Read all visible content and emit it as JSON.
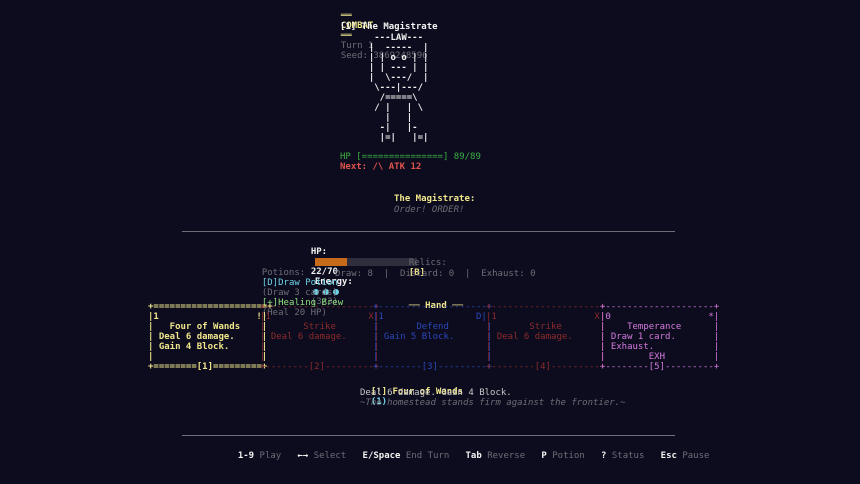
{
  "header": {
    "mode_label": "COMBAT",
    "turn": "Turn 1",
    "seed": "Seed: 3869248596"
  },
  "enemy": {
    "title": "[1] The Magistrate",
    "art": "   ---LAW---\n  |  -----  |\n  | | o o | |\n  | | --- | |\n  |  \\---/  |\n   \\---|---/\n    /=====\\\n   / |   | \\\n     |   |\n    -|   |-\n    |=|   |=|",
    "hp_bar": "HP [===============] 89/89",
    "intent": "Next: /\\ ATK 12",
    "speaker": "The Magistrate:",
    "dialogue": "Order! ORDER!"
  },
  "player": {
    "hp_label": "HP:",
    "hp_value": "22/70",
    "hp_fraction": 0.314,
    "energy_label": "Energy:",
    "energy_text": "(3/3)",
    "energy_current": 3,
    "relics_label": "Relics:",
    "relics_value": "[B]",
    "potions_label": "Potions:",
    "potion1_key": "[D]",
    "potion1_name": "Draw Potion",
    "potion1_desc": "(Draw 3 cards)",
    "potion2_key": "[+]",
    "potion2_name": "Healing Brew",
    "potion2_desc": "(Heal 20 HP)",
    "piles": "Draw: 8  |  Discard: 0  |  Exhaust: 0"
  },
  "hand": {
    "title": "Hand",
    "cards": [
      {
        "text": "+=====================+\n|1                  !|\n|   Four of Wands    |\n| Deal 6 damage.     |\n| Gain 4 Block.      |\n|                    |\n+========[1]=========+",
        "color": "#f0e68c"
      },
      {
        "text": "+--------------------+\n|1                  X|\n|       Strike       |\n| Deal 6 damage.     |\n|                    |\n|                    |\n+--------[2]---------+",
        "color": "#8e2a2a"
      },
      {
        "text": "+--------------------+\n|1                 D|\n|       Defend       |\n| Gain 5 Block.      |\n|                    |\n|                    |\n+--------[3]---------+",
        "color": "#2b48b8"
      },
      {
        "text": "+--------------------+\n|1                  X|\n|       Strike       |\n| Deal 6 damage.     |\n|                    |\n|                    |\n+--------[4]---------+",
        "color": "#8e2a2a"
      },
      {
        "text": "+--------------------+\n|0                  *|\n|    Temperance      |\n| Draw 1 card.       |\n| Exhaust.           |\n|        EXH         |\n+--------[5]---------+",
        "color": "#d77be0"
      }
    ],
    "selected_title": "[!] Four of Wands",
    "selected_cost": "(1)",
    "selected_desc": "Deal 6 damage. Gain 4 Block.",
    "selected_flavor": "~The homestead stands firm against the frontier.~"
  },
  "footer": {
    "hints": [
      {
        "key": "1-9",
        "label": "Play"
      },
      {
        "key": "←→",
        "label": "Select"
      },
      {
        "key": "E/Space",
        "label": "End Turn"
      },
      {
        "key": "Tab",
        "label": "Reverse"
      },
      {
        "key": "P",
        "label": "Potion"
      },
      {
        "key": "?",
        "label": "Status"
      },
      {
        "key": "Esc",
        "label": "Pause"
      }
    ]
  }
}
